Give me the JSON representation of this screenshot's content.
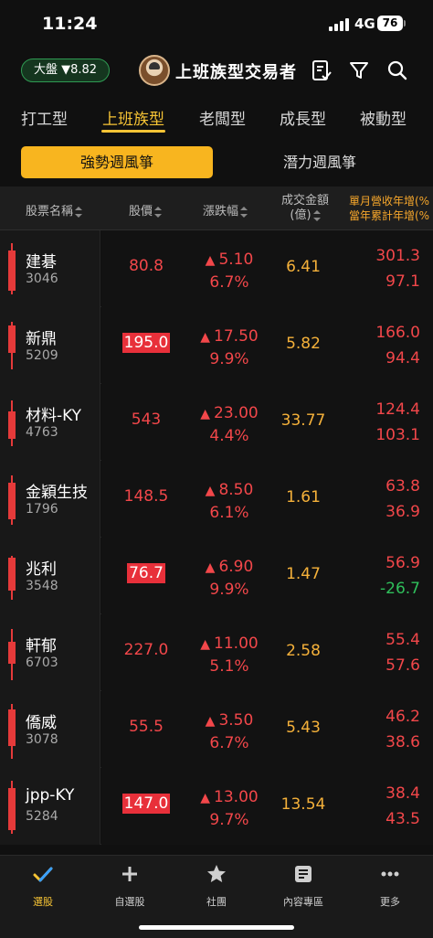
{
  "status": {
    "time": "11:24",
    "network": "4G",
    "battery": "76"
  },
  "header": {
    "index_badge": "大盤 ▼8.82",
    "title": "上班族型交易者"
  },
  "category_tabs": [
    {
      "label": "打工型"
    },
    {
      "label": "上班族型"
    },
    {
      "label": "老闆型"
    },
    {
      "label": "成長型"
    },
    {
      "label": "被動型"
    }
  ],
  "active_category": "上班族型",
  "sub_tabs": {
    "active": "強勢週風箏",
    "inactive": "潛力週風箏"
  },
  "table": {
    "headers": {
      "name": "股票名稱",
      "price": "股價",
      "change": "漲跌幅",
      "amount_1": "成交金額",
      "amount_2": "(億)",
      "growth_1": "單月營收年增(%",
      "growth_2": "當年累計年增(%"
    },
    "rows": [
      {
        "name": "建碁",
        "code": "3046",
        "price": "80.8",
        "price_highlight": false,
        "change": "5.10",
        "change_pct": "6.7%",
        "amount": "6.41",
        "growth_month": "301.3",
        "growth_ytd": "97.1",
        "growth_ytd_color": "red"
      },
      {
        "name": "新鼎",
        "code": "5209",
        "price": "195.0",
        "price_highlight": true,
        "change": "17.50",
        "change_pct": "9.9%",
        "amount": "5.82",
        "growth_month": "166.0",
        "growth_ytd": "94.4",
        "growth_ytd_color": "red"
      },
      {
        "name": "材料-KY",
        "code": "4763",
        "price": "543",
        "price_highlight": false,
        "change": "23.00",
        "change_pct": "4.4%",
        "amount": "33.77",
        "growth_month": "124.4",
        "growth_ytd": "103.1",
        "growth_ytd_color": "red"
      },
      {
        "name": "金穎生技",
        "code": "1796",
        "price": "148.5",
        "price_highlight": false,
        "change": "8.50",
        "change_pct": "6.1%",
        "amount": "1.61",
        "growth_month": "63.8",
        "growth_ytd": "36.9",
        "growth_ytd_color": "red"
      },
      {
        "name": "兆利",
        "code": "3548",
        "price": "76.7",
        "price_highlight": true,
        "change": "6.90",
        "change_pct": "9.9%",
        "amount": "1.47",
        "growth_month": "56.9",
        "growth_ytd": "-26.7",
        "growth_ytd_color": "green"
      },
      {
        "name": "軒郁",
        "code": "6703",
        "price": "227.0",
        "price_highlight": false,
        "change": "11.00",
        "change_pct": "5.1%",
        "amount": "2.58",
        "growth_month": "55.4",
        "growth_ytd": "57.6",
        "growth_ytd_color": "red"
      },
      {
        "name": "僑威",
        "code": "3078",
        "price": "55.5",
        "price_highlight": false,
        "change": "3.50",
        "change_pct": "6.7%",
        "amount": "5.43",
        "growth_month": "46.2",
        "growth_ytd": "38.6",
        "growth_ytd_color": "red"
      },
      {
        "name": "jpp-KY",
        "code": "5284",
        "price": "147.0",
        "price_highlight": true,
        "change": "13.00",
        "change_pct": "9.7%",
        "amount": "13.54",
        "growth_month": "38.4",
        "growth_ytd": "43.5",
        "growth_ytd_color": "red"
      }
    ]
  },
  "bottom_nav": [
    {
      "label": "選股",
      "icon": "check-chart-icon",
      "active": true
    },
    {
      "label": "自選股",
      "icon": "plus-icon",
      "active": false
    },
    {
      "label": "社團",
      "icon": "star-icon",
      "active": false
    },
    {
      "label": "內容專區",
      "icon": "document-icon",
      "active": false
    },
    {
      "label": "更多",
      "icon": "more-icon",
      "active": false
    }
  ],
  "colors": {
    "accent": "#f7c435",
    "up": "#f2474a",
    "down": "#2fbf5b",
    "amount": "#f5b13a"
  }
}
